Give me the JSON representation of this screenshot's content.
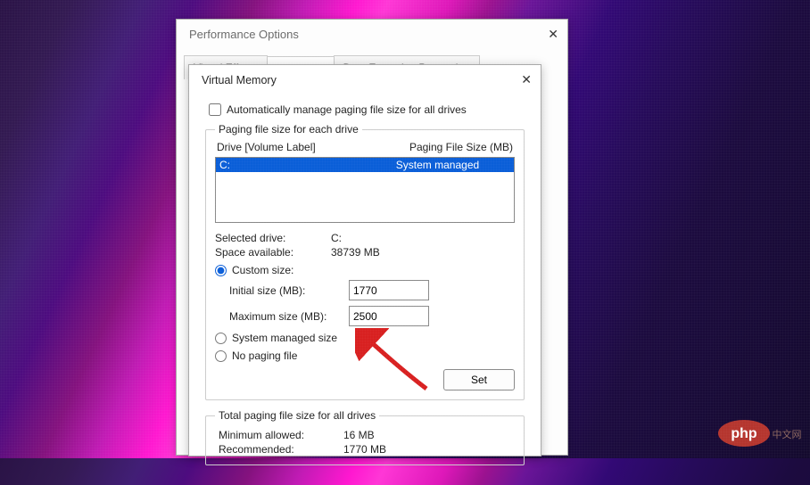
{
  "perfWindow": {
    "title": "Performance Options"
  },
  "tabs": {
    "visual": "Visual Effects",
    "advanced": "Advanced",
    "dep": "Data Execution Prevention"
  },
  "vmWindow": {
    "title": "Virtual Memory"
  },
  "autoManage": {
    "label": "Automatically manage paging file size for all drives",
    "checked": false
  },
  "driveSection": {
    "legend": "Paging file size for each drive",
    "headerDrive": "Drive  [Volume Label]",
    "headerSize": "Paging File Size (MB)",
    "rows": [
      {
        "drive": "C:",
        "size": "System managed",
        "selected": true
      }
    ]
  },
  "selected": {
    "driveLabel": "Selected drive:",
    "driveValue": "C:",
    "spaceLabel": "Space available:",
    "spaceValue": "38739 MB"
  },
  "sizeOptions": {
    "custom": "Custom size:",
    "initialLabel": "Initial size (MB):",
    "initialValue": "1770",
    "maxLabel": "Maximum size (MB):",
    "maxValue": "2500",
    "system": "System managed size",
    "none": "No paging file",
    "selected": "custom"
  },
  "setButton": "Set",
  "totals": {
    "legend": "Total paging file size for all drives",
    "minLabel": "Minimum allowed:",
    "minValue": "16 MB",
    "recLabel": "Recommended:",
    "recValue": "1770 MB"
  },
  "watermark": {
    "brand": "php",
    "suffix": "中文网"
  }
}
